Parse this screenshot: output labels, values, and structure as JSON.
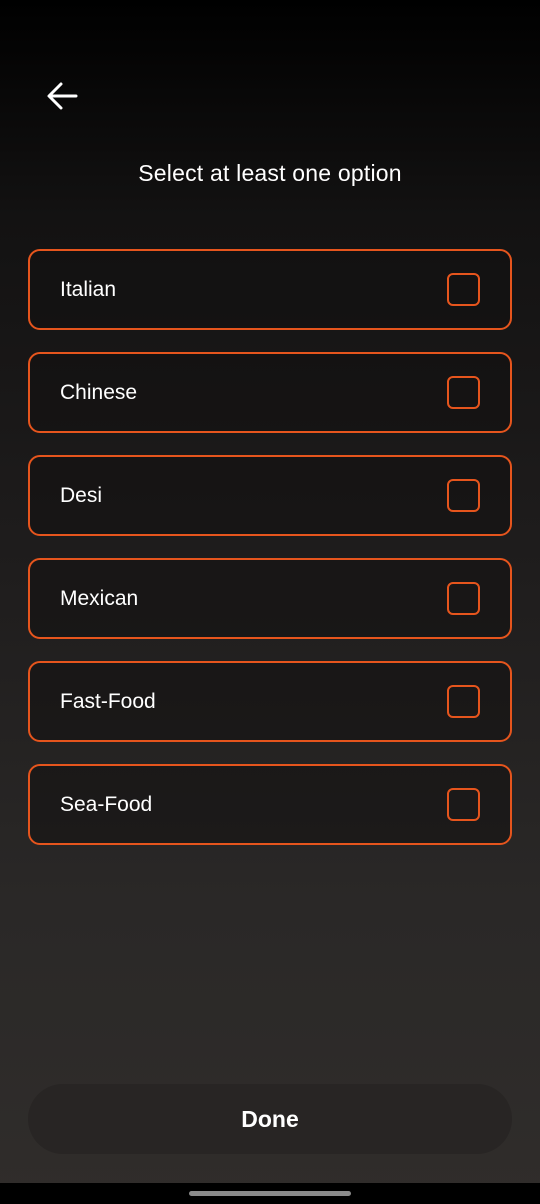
{
  "header": {
    "back_icon": "arrow-left-icon",
    "title": "Select at least one option"
  },
  "options": [
    {
      "label": "Italian",
      "checked": false
    },
    {
      "label": "Chinese",
      "checked": false
    },
    {
      "label": "Desi",
      "checked": false
    },
    {
      "label": "Mexican",
      "checked": false
    },
    {
      "label": "Fast-Food",
      "checked": false
    },
    {
      "label": "Sea-Food",
      "checked": false
    }
  ],
  "footer": {
    "done_label": "Done"
  },
  "colors": {
    "accent": "#e6551d",
    "background_top": "#000000",
    "background_bottom": "#302d2b",
    "text": "#ffffff"
  }
}
